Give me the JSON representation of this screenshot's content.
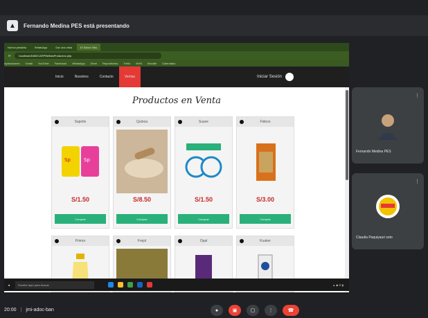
{
  "meet": {
    "presenting_text": "Fernando Medina PES está presentando",
    "time": "20:00",
    "meeting_code": "jmi-adoc-ban"
  },
  "browser": {
    "tabs": [
      "Nueva pestaña",
      "WhatsApp",
      "Dar una vista",
      "El Sabor Sitio"
    ],
    "url": "localhost:8080/CARPIN/listaProductos.php",
    "bookmarks": [
      "Aplicaciones",
      "Gmail",
      "YouTube",
      "Facebook",
      "WhatsApp",
      "Drive",
      "Repositorios",
      "Trello",
      "MVN",
      "Moodle",
      "Calendario"
    ]
  },
  "site": {
    "nav": [
      "Inicio",
      "Nosotros",
      "Contacto",
      "Ventas"
    ],
    "login_label": "Iniciar Sesión",
    "heading": "Productos en Venta",
    "buy_label": "Comprar",
    "products_row1": [
      {
        "name": "Sapolio",
        "price": "S/1.50"
      },
      {
        "name": "Quinoa",
        "price": "S/8.50"
      },
      {
        "name": "Suave",
        "price": "S/1.50"
      },
      {
        "name": "Fideos",
        "price": "S/3.00"
      }
    ],
    "products_row2": [
      {
        "name": "Primor"
      },
      {
        "name": "Frejol"
      },
      {
        "name": "Opal"
      },
      {
        "name": "Kuaker"
      }
    ]
  },
  "taskbar": {
    "search_placeholder": "Escribe aquí para buscar"
  },
  "participants": [
    {
      "name": "Fernando Medina PES"
    },
    {
      "name": "Claudia Paquiyauri soto"
    }
  ]
}
